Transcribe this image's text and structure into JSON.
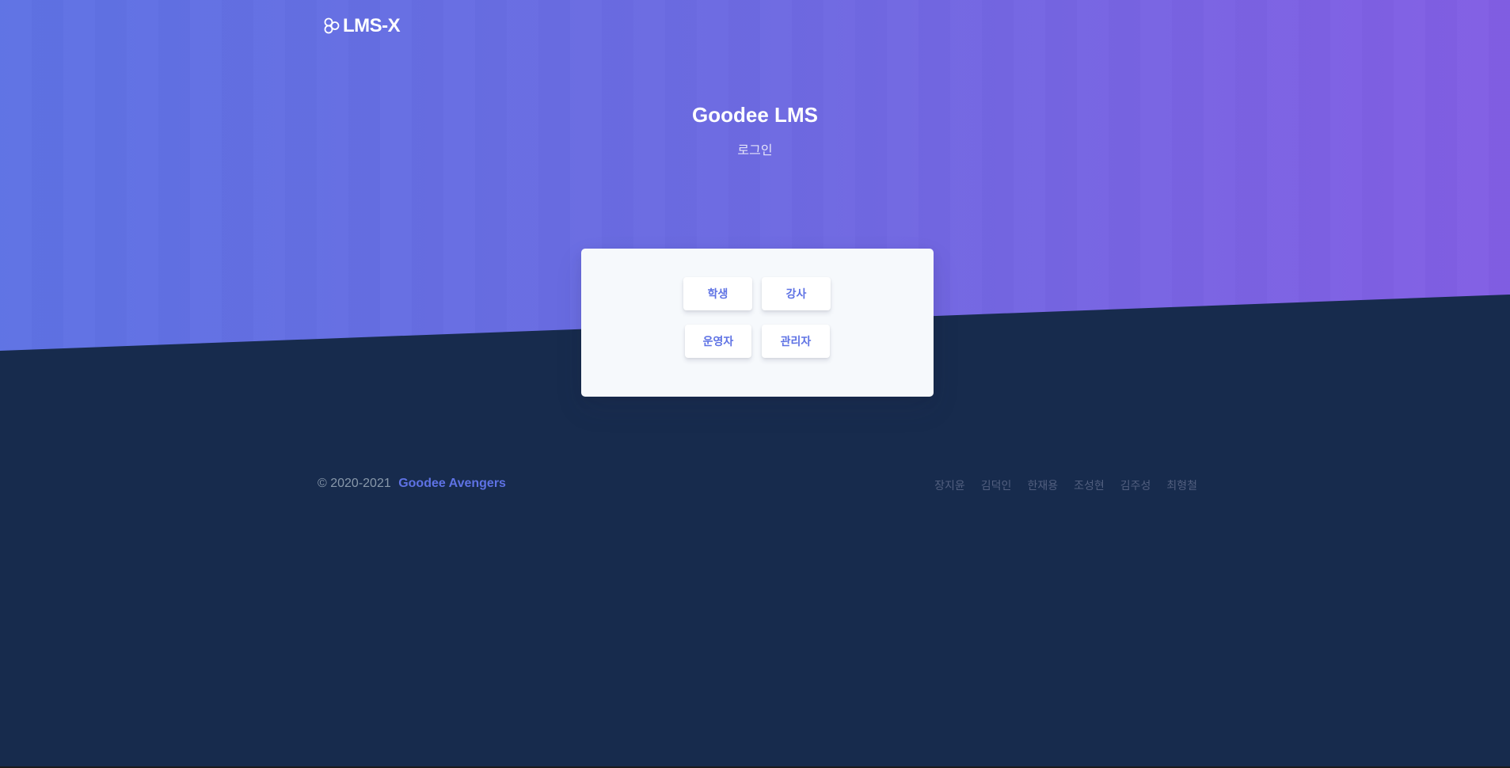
{
  "brand": {
    "name": "LMS-X",
    "icon": "three-circles-logo-icon"
  },
  "hero": {
    "title": "Goodee LMS",
    "subtitle": "로그인"
  },
  "login_roles": [
    "학생",
    "강사",
    "운영자",
    "관리자"
  ],
  "footer": {
    "copyright": "© 2020-2021",
    "team_link": "Goodee Avengers",
    "members": [
      "장지윤",
      "김덕인",
      "한재용",
      "조성현",
      "김주성",
      "최형철"
    ]
  },
  "colors": {
    "gradient_start": "#5e72e4",
    "gradient_end": "#825ee4",
    "dark_background": "#172b4d",
    "card_background": "#f6f9fc",
    "accent": "#5e72e4"
  }
}
